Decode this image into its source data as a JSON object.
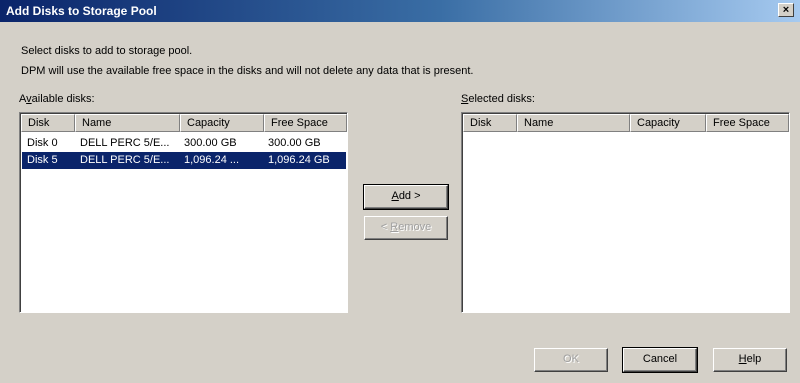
{
  "window": {
    "title": "Add Disks to Storage Pool",
    "close_label": "×"
  },
  "intro": {
    "line1": "Select disks to add to storage pool.",
    "line2": "DPM will use the available free space in the disks and will not delete any data that is present."
  },
  "available": {
    "label_prefix": "A",
    "label_accel": "v",
    "label_rest": "ailable disks:",
    "columns": [
      "Disk",
      "Name",
      "Capacity",
      "Free Space"
    ],
    "rows": [
      {
        "disk": "Disk 0",
        "name": "DELL PERC 5/E...",
        "capacity": "300.00 GB",
        "free": "300.00 GB",
        "selected": false
      },
      {
        "disk": "Disk 5",
        "name": "DELL PERC 5/E...",
        "capacity": "1,096.24 ...",
        "free": "1,096.24 GB",
        "selected": true
      }
    ]
  },
  "selected": {
    "label_accel": "S",
    "label_rest": "elected disks:",
    "columns": [
      "Disk",
      "Name",
      "Capacity",
      "Free Space"
    ],
    "rows": []
  },
  "buttons": {
    "add": {
      "accel": "A",
      "rest": "dd >"
    },
    "remove": {
      "prefix": "< ",
      "accel": "R",
      "rest": "emove"
    },
    "ok": "OK",
    "cancel": "Cancel",
    "help": {
      "accel": "H",
      "rest": "elp"
    }
  }
}
